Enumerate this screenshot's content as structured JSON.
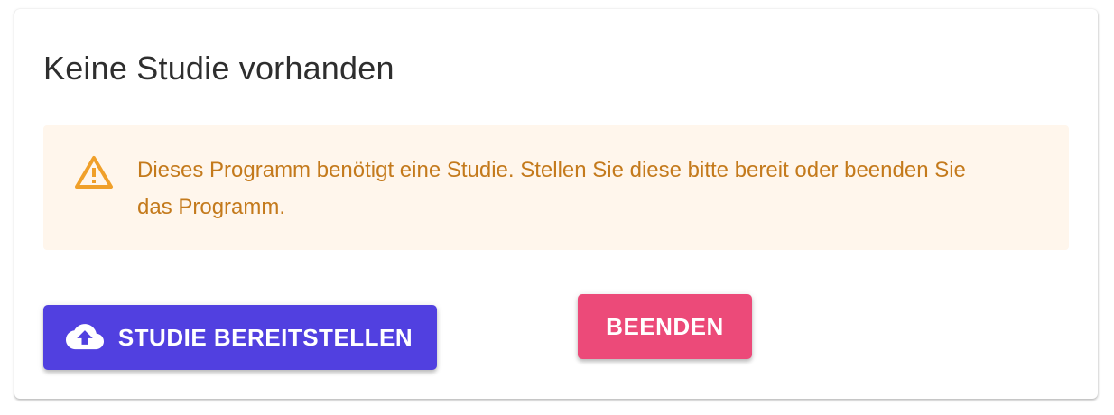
{
  "dialog": {
    "title": "Keine Studie vorhanden",
    "alert": {
      "icon": "warning-triangle-icon",
      "message": "Dieses Programm benötigt eine Studie. Stellen Sie diese bitte bereit oder beenden Sie das Programm.",
      "text_color": "#c47a1c",
      "background": "#fff6ec",
      "icon_color": "#f0a02a"
    },
    "buttons": {
      "provide_label": "STUDIE BEREITSTELLEN",
      "provide_icon": "cloud-upload-icon",
      "provide_color": "#5140e0",
      "quit_label": "BEENDEN",
      "quit_color": "#ec4a79"
    }
  }
}
